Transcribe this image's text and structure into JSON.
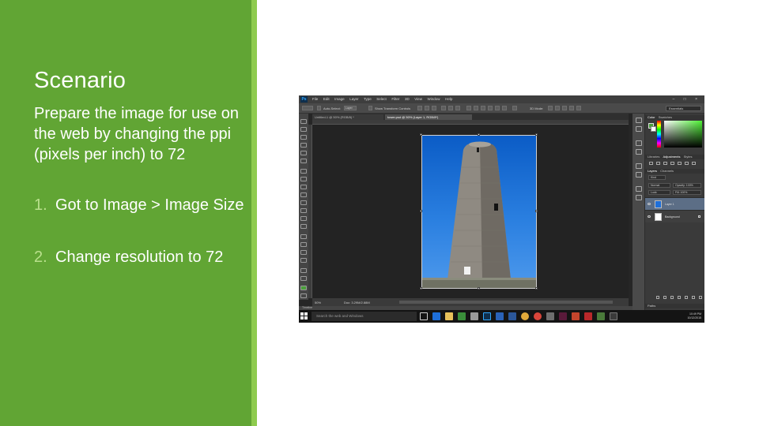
{
  "slide": {
    "title": "Scenario",
    "body": "Prepare the image for use on the web by changing the ppi (pixels per inch) to 72",
    "steps": [
      {
        "number": "1.",
        "text": "Got to Image > Image Size"
      },
      {
        "number": "2.",
        "text": "Change resolution to 72"
      }
    ],
    "colors": {
      "panel": "#61a534",
      "stripe": "#8ecb4e",
      "number": "#b9e08c"
    }
  },
  "photoshop": {
    "logo": "Ps",
    "menu": [
      "File",
      "Edit",
      "Image",
      "Layer",
      "Type",
      "Select",
      "Filter",
      "3D",
      "View",
      "Window",
      "Help"
    ],
    "options": {
      "auto_select": "Auto-Select:",
      "layer_select": "Layer",
      "show_transform": "Show Transform Controls",
      "mode_3d": "3D Mode:",
      "workspace": "Essentials"
    },
    "doc_tabs": [
      {
        "label": "Untitled-1 @ 50% (RGB/8) *",
        "active": false
      },
      {
        "label": "tower.psd @ 50% (Layer 1, RGB/8*)",
        "active": true
      }
    ],
    "status": {
      "zoom": "50%",
      "doc": "Doc: 3.29M/2.88M"
    },
    "timeline": "Timeline",
    "panels": {
      "color_tabs": [
        "Color",
        "Swatches"
      ],
      "adjust_tabs": [
        "Libraries",
        "Adjustments",
        "Styles"
      ],
      "layer_tabs": [
        "Layers",
        "Channels"
      ],
      "kind_label": "Kind",
      "blend_mode": "Normal",
      "opacity": "Opacity: 100%",
      "lock": "Lock:",
      "fill": "Fill: 100%",
      "layers": [
        {
          "name": "Layer 1",
          "selected": true
        },
        {
          "name": "Background",
          "selected": false
        }
      ],
      "paths": "Paths"
    },
    "taskbar": {
      "search_placeholder": "Search the web and Windows",
      "time": "10:49 PM",
      "date": "10/12/2015"
    }
  }
}
